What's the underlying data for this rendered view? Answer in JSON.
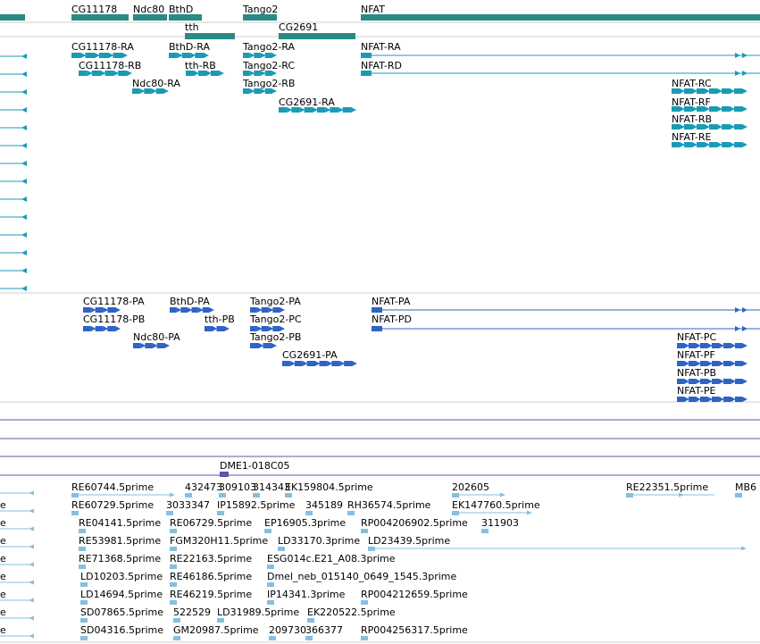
{
  "colors": {
    "gene_span": "#2a8a85",
    "transcript": "#1a9bb5",
    "protein": "#2e64c4",
    "est": "#86bfe0",
    "clone": "#6a4fa8",
    "separator": "#cfcfcf",
    "clone_line": "#6a4fa8"
  },
  "tracks": {
    "genes": [
      {
        "name": "CG11178",
        "row": 0
      },
      {
        "name": "Ndc80",
        "row": 0
      },
      {
        "name": "BthD",
        "row": 0
      },
      {
        "name": "Tango2",
        "row": 0
      },
      {
        "name": "NFAT",
        "row": 0
      },
      {
        "name": "tth",
        "row": 1
      },
      {
        "name": "CG2691",
        "row": 1
      }
    ],
    "transcripts": [
      {
        "name": "CG11178-RA"
      },
      {
        "name": "CG11178-RB"
      },
      {
        "name": "Ndc80-RA"
      },
      {
        "name": "BthD-RA"
      },
      {
        "name": "tth-RB"
      },
      {
        "name": "Tango2-RA"
      },
      {
        "name": "Tango2-RC"
      },
      {
        "name": "Tango2-RB"
      },
      {
        "name": "CG2691-RA"
      },
      {
        "name": "NFAT-RA"
      },
      {
        "name": "NFAT-RD"
      },
      {
        "name": "NFAT-RC"
      },
      {
        "name": "NFAT-RF"
      },
      {
        "name": "NFAT-RB"
      },
      {
        "name": "NFAT-RE"
      }
    ],
    "proteins": [
      {
        "name": "CG11178-PA"
      },
      {
        "name": "CG11178-PB"
      },
      {
        "name": "Ndc80-PA"
      },
      {
        "name": "BthD-PA"
      },
      {
        "name": "tth-PB"
      },
      {
        "name": "Tango2-PA"
      },
      {
        "name": "Tango2-PC"
      },
      {
        "name": "Tango2-PB"
      },
      {
        "name": "CG2691-PA"
      },
      {
        "name": "NFAT-PA"
      },
      {
        "name": "NFAT-PD"
      },
      {
        "name": "NFAT-PC"
      },
      {
        "name": "NFAT-PF"
      },
      {
        "name": "NFAT-PB"
      },
      {
        "name": "NFAT-PE"
      }
    ],
    "clone": {
      "name": "DME1-018C05"
    },
    "ests": [
      {
        "name": "RE60744.5prime"
      },
      {
        "name": "432473"
      },
      {
        "name": "309103"
      },
      {
        "name": "314343"
      },
      {
        "name": "EK159804.5prime"
      },
      {
        "name": "202605"
      },
      {
        "name": "RE22351.5prime"
      },
      {
        "name": "MB6"
      },
      {
        "name": "RE60729.5prime"
      },
      {
        "name": "3033347"
      },
      {
        "name": "IP15892.5prime"
      },
      {
        "name": "345189"
      },
      {
        "name": "RH36574.5prime"
      },
      {
        "name": "EK147760.5prime"
      },
      {
        "name": "RE04141.5prime"
      },
      {
        "name": "RE06729.5prime"
      },
      {
        "name": "EP16905.3prime"
      },
      {
        "name": "RP004206902.5prime"
      },
      {
        "name": "311903"
      },
      {
        "name": "RE53981.5prime"
      },
      {
        "name": "FGM320H11.5prime"
      },
      {
        "name": "LD33170.3prime"
      },
      {
        "name": "LD23439.5prime"
      },
      {
        "name": "RE71368.5prime"
      },
      {
        "name": "RE22163.5prime"
      },
      {
        "name": "ESG014c.E21_A08.3prime"
      },
      {
        "name": "LD10203.5prime"
      },
      {
        "name": "RE46186.5prime"
      },
      {
        "name": "Dmel_neb_015140_0649_1545.3prime"
      },
      {
        "name": "LD14694.5prime"
      },
      {
        "name": "RE46219.5prime"
      },
      {
        "name": "IP14341.3prime"
      },
      {
        "name": "RP004212659.5prime"
      },
      {
        "name": "SD07865.5prime"
      },
      {
        "name": "522529"
      },
      {
        "name": "LD31989.5prime"
      },
      {
        "name": "EK220522.5prime"
      },
      {
        "name": "SD04316.5prime"
      },
      {
        "name": "GM20987.5prime"
      },
      {
        "name": "209730"
      },
      {
        "name": "366377"
      },
      {
        "name": "RP004256317.5prime"
      }
    ],
    "left_partial_labels": [
      {
        "name": "e"
      },
      {
        "name": "e"
      },
      {
        "name": "e"
      },
      {
        "name": "e"
      },
      {
        "name": "e"
      },
      {
        "name": "e"
      },
      {
        "name": "e"
      },
      {
        "name": "e"
      }
    ]
  }
}
